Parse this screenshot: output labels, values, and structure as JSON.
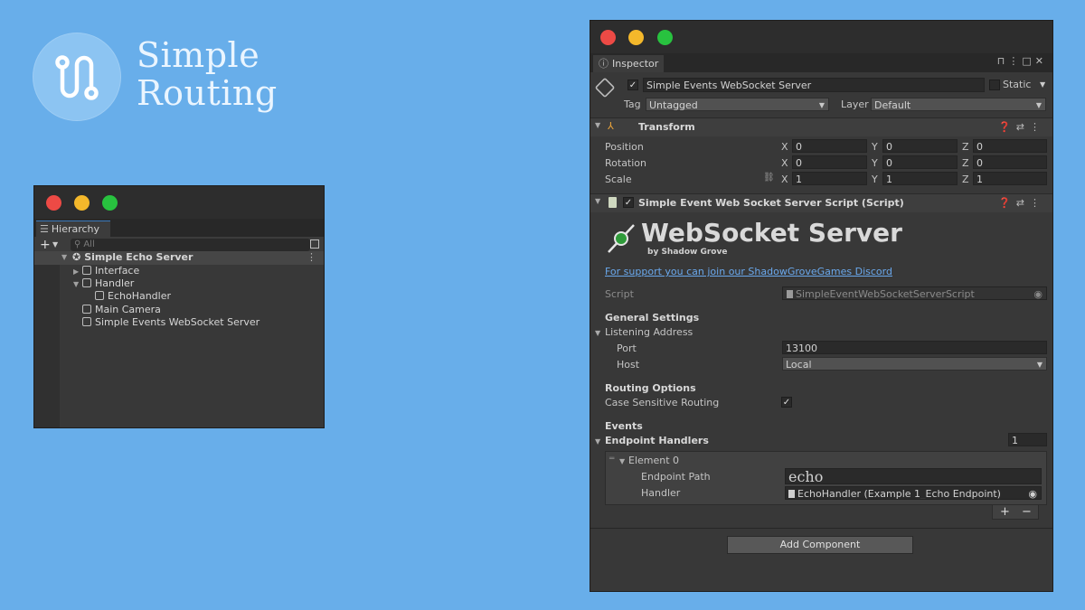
{
  "brand": {
    "line1": "Simple",
    "line2": "Routing"
  },
  "hierarchy": {
    "tab": "Hierarchy",
    "search_placeholder": "All",
    "items": [
      {
        "label": "Simple Echo Server"
      },
      {
        "label": "Interface"
      },
      {
        "label": "Handler"
      },
      {
        "label": "EchoHandler"
      },
      {
        "label": "Main Camera"
      },
      {
        "label": "Simple Events WebSocket Server"
      }
    ]
  },
  "inspector": {
    "tab": "Inspector",
    "object_name": "Simple Events WebSocket Server",
    "static_label": "Static",
    "tag_label": "Tag",
    "tag_value": "Untagged",
    "layer_label": "Layer",
    "layer_value": "Default",
    "transform": {
      "title": "Transform",
      "rows": [
        {
          "label": "Position",
          "x": "0",
          "y": "0",
          "z": "0"
        },
        {
          "label": "Rotation",
          "x": "0",
          "y": "0",
          "z": "0"
        },
        {
          "label": "Scale",
          "x": "1",
          "y": "1",
          "z": "1"
        }
      ],
      "axis": {
        "x": "X",
        "y": "Y",
        "z": "Z"
      }
    },
    "script_component": {
      "title": "Simple Event Web Socket Server Script (Script)",
      "banner_title": "WebSocket Server",
      "banner_sub": "by Shadow Grove",
      "support_link": "For support you can join our ShadowGroveGames Discord",
      "script_label": "Script",
      "script_value": "SimpleEventWebSocketServerScript",
      "general_settings": "General Settings",
      "listening_address": "Listening Address",
      "port_label": "Port",
      "port_value": "13100",
      "host_label": "Host",
      "host_value": "Local",
      "routing_options": "Routing Options",
      "case_sensitive_label": "Case Sensitive Routing",
      "events": "Events",
      "endpoint_handlers": "Endpoint Handlers",
      "endpoint_count": "1",
      "element_label": "Element 0",
      "endpoint_path_label": "Endpoint Path",
      "endpoint_path_value": "echo",
      "handler_label": "Handler",
      "handler_value": "EchoHandler (Example 1_Echo Endpoint)",
      "plus": "+",
      "minus": "−"
    },
    "add_component": "Add Component"
  },
  "colors": {
    "background": "#68aeea",
    "panel": "#383838",
    "link": "#6aa8ec"
  }
}
